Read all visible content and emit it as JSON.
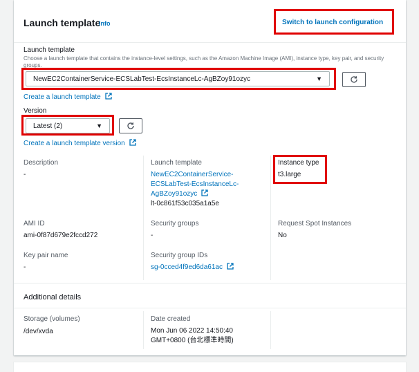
{
  "header": {
    "title": "Launch template",
    "info": "Info",
    "switch_link": "Switch to launch configuration"
  },
  "launch_template_field": {
    "label": "Launch template",
    "description": "Choose a launch template that contains the instance-level settings, such as the Amazon Machine Image (AMI), instance type, key pair, and security groups.",
    "selected": "NewEC2ContainerService-ECSLabTest-EcsInstanceLc-AgBZoy91ozyc",
    "create_link": "Create a launch template"
  },
  "version_field": {
    "label": "Version",
    "selected": "Latest (2)",
    "create_link": "Create a launch template version"
  },
  "details": {
    "description_key": "Description",
    "description_value": "-",
    "launch_template_key": "Launch template",
    "launch_template_line1": "NewEC2ContainerService-",
    "launch_template_line2": "ECSLabTest-EcsInstanceLc-",
    "launch_template_line3": "AgBZoy91ozyc",
    "launch_template_id": "lt-0c861f53c035a1a5e",
    "instance_type_key": "Instance type",
    "instance_type_value": "t3.large",
    "ami_key": "AMI ID",
    "ami_value": "ami-0f87d679e2fccd272",
    "security_groups_key": "Security groups",
    "security_groups_value": "-",
    "spot_key": "Request Spot Instances",
    "spot_value": "No",
    "key_pair_key": "Key pair name",
    "key_pair_value": "-",
    "sg_ids_key": "Security group IDs",
    "sg_ids_value": "sg-0cced4f9ed6da61ac"
  },
  "additional": {
    "title": "Additional details",
    "storage_key": "Storage (volumes)",
    "storage_value": "/dev/xvda",
    "date_key": "Date created",
    "date_line1": "Mon Jun 06 2022 14:50:40",
    "date_line2": "GMT+0800 (台北標準時間)"
  },
  "colors": {
    "link": "#0073bb",
    "highlight": "#e00000"
  },
  "icons": [
    "refresh-icon",
    "external-link-icon",
    "caret-down-icon"
  ]
}
